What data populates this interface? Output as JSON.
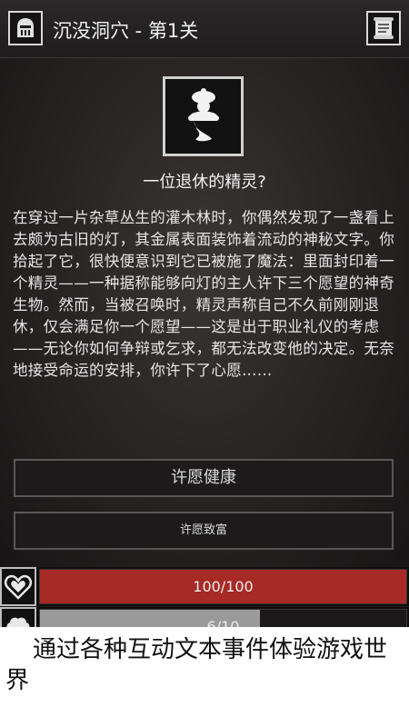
{
  "header": {
    "title": "沉没洞穴 - 第1关",
    "left_icon": "helmet-icon",
    "right_icon": "scroll-icon"
  },
  "event": {
    "icon": "genie-icon",
    "title": "一位退休的精灵?",
    "body": "在穿过一片杂草丛生的灌木林时，你偶然发现了一盏看上去颇为古旧的灯，其金属表面装饰着流动的神秘文字。你拾起了它，很快便意识到它已被施了魔法：里面封印着一个精灵——一种据称能够向灯的主人许下三个愿望的神奇生物。然而，当被召唤时，精灵声称自己不久前刚刚退休，仅会满足你一个愿望——这是出于职业礼仪的考虑——无论你如何争辩或乞求，都无法改变他的决定。无奈地接受命运的安排，你许下了心愿……"
  },
  "choices": [
    {
      "label": "许愿健康"
    },
    {
      "label": "许愿致富"
    }
  ],
  "stats": {
    "hp": {
      "text": "100/100",
      "fraction": 1.0,
      "icon": "heart-icon",
      "color": "#a82a26"
    },
    "sp": {
      "text": "6/10",
      "fraction": 0.6,
      "icon": "brain-icon",
      "color": "#9a9a9a"
    }
  },
  "caption": "通过各种互动文本事件体验游戏世界"
}
